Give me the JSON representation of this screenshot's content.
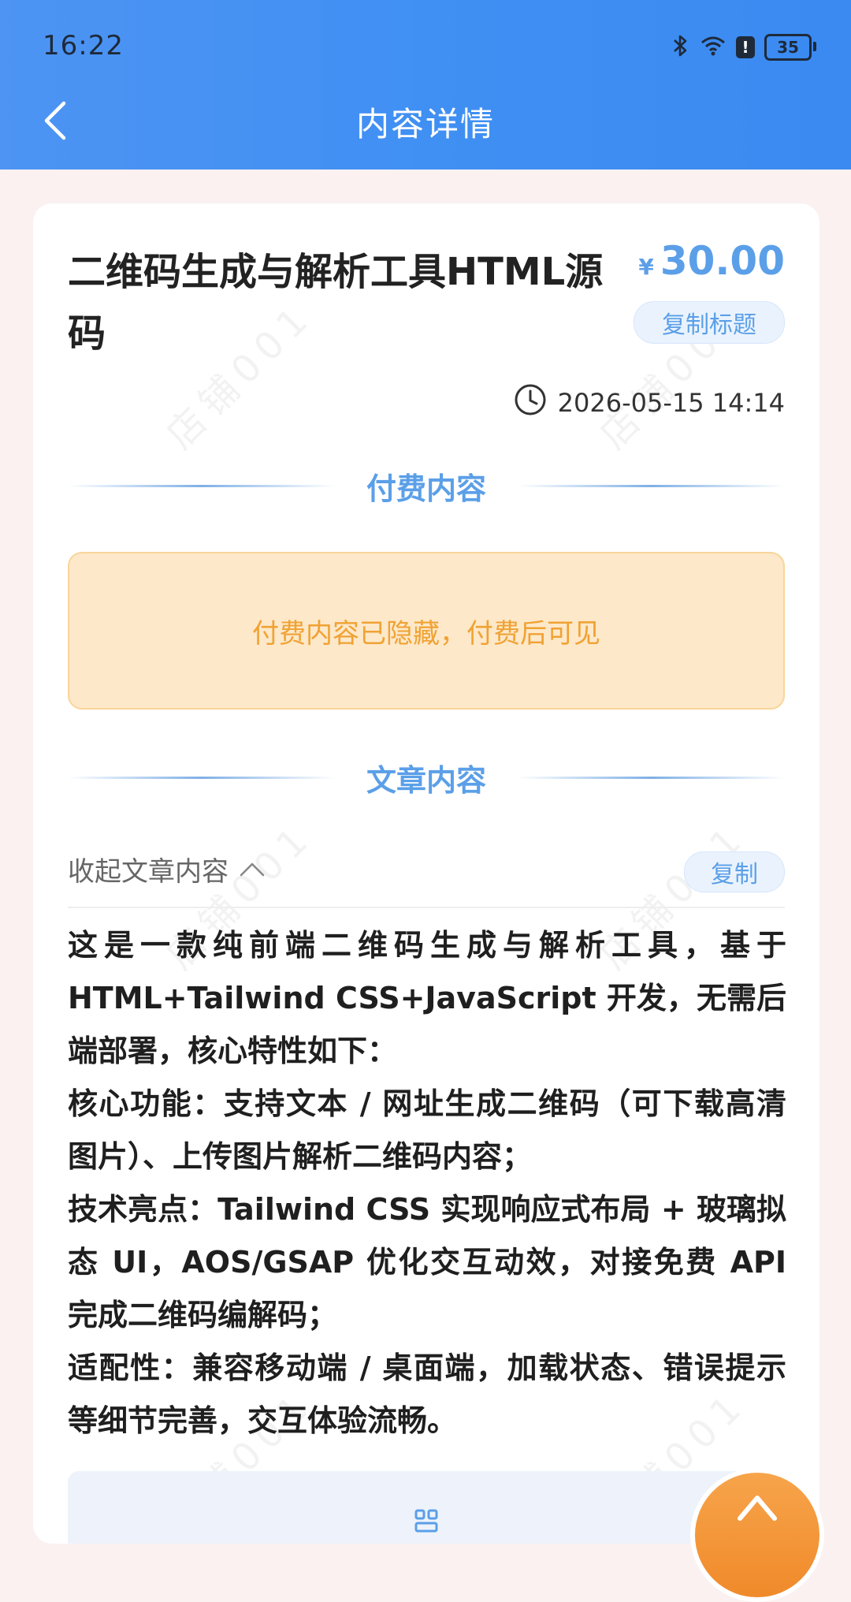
{
  "status_bar": {
    "time": "16:22",
    "battery": "35",
    "alert": "!"
  },
  "nav": {
    "title": "内容详情"
  },
  "item": {
    "title": "二维码生成与解析工具HTML源码",
    "currency": "¥",
    "price": "30.00",
    "copy_title_label": "复制标题",
    "date": "2026-05-15 14:14"
  },
  "paid_section": {
    "label": "付费内容",
    "hidden_text": "付费内容已隐藏，付费后可见"
  },
  "article_section": {
    "label": "文章内容",
    "collapse_label": "收起文章内容",
    "copy_label": "复制",
    "paragraphs": [
      "这是一款纯前端二维码生成与解析工具，基于 HTML+Tailwind CSS+JavaScript 开发，无需后端部署，核心特性如下：",
      "核心功能：支持文本 / 网址生成二维码（可下载高清图片）、上传图片解析二维码内容；",
      "技术亮点：Tailwind CSS 实现响应式布局 + 玻璃拟态 UI，AOS/GSAP 优化交互动效，对接免费 API 完成二维码编解码；",
      "适配性：兼容移动端 / 桌面端，加载状态、错误提示等细节完善，交互体验流畅。"
    ]
  },
  "watermark": "店铺001",
  "colors": {
    "header": "#3f8ff3",
    "accent": "#5b9fe8",
    "warning_bg": "#fde8c9",
    "warning_text": "#f0a233",
    "fab": "#f29436"
  }
}
